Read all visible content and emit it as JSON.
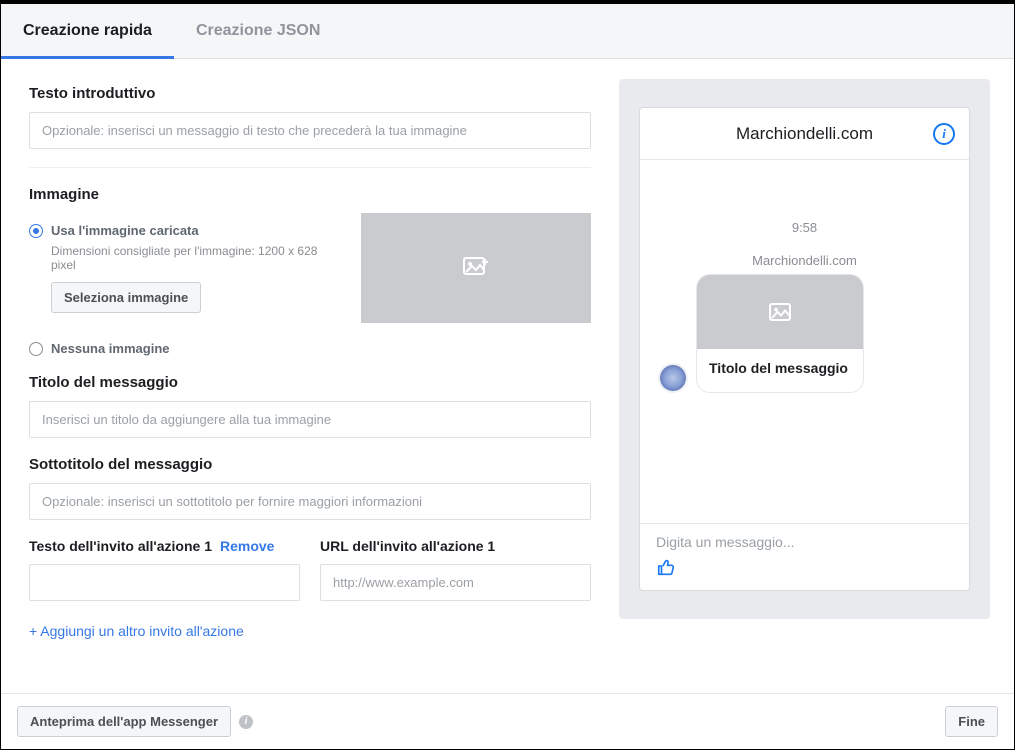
{
  "tabs": {
    "quick": "Creazione rapida",
    "json": "Creazione JSON"
  },
  "form": {
    "intro_label": "Testo introduttivo",
    "intro_placeholder": "Opzionale: inserisci un messaggio di testo che precederà la tua immagine",
    "image_label": "Immagine",
    "image_opt_uploaded": "Usa l'immagine caricata",
    "image_size_hint": "Dimensioni consigliate per l'immagine: 1200 x 628 pixel",
    "image_select_btn": "Seleziona immagine",
    "image_opt_none": "Nessuna immagine",
    "title_label": "Titolo del messaggio",
    "title_placeholder": "Inserisci un titolo da aggiungere alla tua immagine",
    "subtitle_label": "Sottotitolo del messaggio",
    "subtitle_placeholder": "Opzionale: inserisci un sottotitolo per fornire maggiori informazioni",
    "cta_text_label": "Testo dell'invito all'azione 1",
    "cta_remove": "Remove",
    "cta_url_label": "URL dell'invito all'azione 1",
    "cta_url_placeholder": "http://www.example.com",
    "add_cta": "+ Aggiungi un altro invito all'azione"
  },
  "preview": {
    "page_name": "Marchiondelli.com",
    "time": "9:58",
    "sender": "Marchiondelli.com",
    "card_title": "Titolo del messaggio",
    "compose_placeholder": "Digita un messaggio..."
  },
  "footer": {
    "messenger_preview": "Anteprima dell'app Messenger",
    "done": "Fine"
  }
}
